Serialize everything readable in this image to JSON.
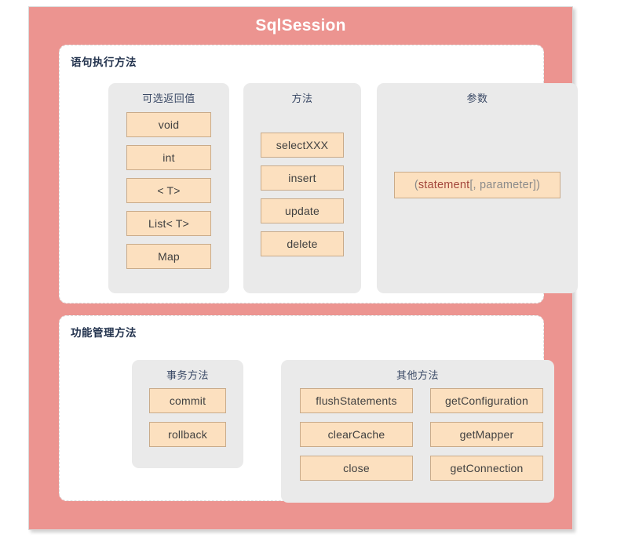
{
  "diagram": {
    "title": "SqlSession",
    "sections": [
      {
        "heading": "语句执行方法",
        "groups": [
          {
            "title": "可选返回值",
            "items": [
              "void",
              "int",
              "< T>",
              "List< T>",
              "Map"
            ]
          },
          {
            "title": "方法",
            "items": [
              "selectXXX",
              "insert",
              "update",
              "delete"
            ]
          },
          {
            "title": "参数",
            "items": [
              "(statement[, parameter])"
            ],
            "param_prefix": "(",
            "param_highlight": "statement",
            "param_suffix": "[, parameter])"
          }
        ]
      },
      {
        "heading": "功能管理方法",
        "groups": [
          {
            "title": "事务方法",
            "items": [
              "commit",
              "rollback"
            ]
          },
          {
            "title": "其他方法",
            "column_left": [
              "flushStatements",
              "clearCache",
              "close"
            ],
            "column_right": [
              "getConfiguration",
              "getMapper",
              "getConnection"
            ]
          }
        ]
      }
    ]
  },
  "colors": {
    "frame": "#ec9490",
    "panel": "#ffffff",
    "group": "#eaeaea",
    "chip_fill": "#fce0bf",
    "chip_border": "#c9ab8a",
    "heading_text": "#24344f",
    "group_title_text": "#3b4a66",
    "highlight_text": "#a3463b"
  }
}
